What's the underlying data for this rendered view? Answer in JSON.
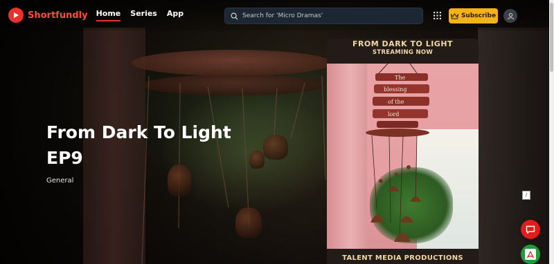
{
  "brand": {
    "name": "Shortfundly",
    "accent": "#e8322b"
  },
  "nav": [
    {
      "label": "Home",
      "active": true
    },
    {
      "label": "Series",
      "active": false
    },
    {
      "label": "App",
      "active": false
    }
  ],
  "search": {
    "placeholder": "Search for 'Micro Dramas'",
    "icon": "search-icon"
  },
  "header_actions": {
    "apps_icon": "grid-icon",
    "subscribe_label": "Subscribe",
    "subscribe_color": "#f2b318",
    "account_icon": "user-icon"
  },
  "hero": {
    "title_line1": "From Dark To Light",
    "title_line2": "EP9",
    "genre": "General"
  },
  "poster": {
    "headline": "FROM DARK TO LIGHT",
    "subline": "STREAMING NOW",
    "credit": "TALENT MEDIA PRODUCTIONS",
    "board_words": [
      "The",
      "blessing",
      "of the",
      "lord"
    ]
  },
  "floating": {
    "tag_text": "/",
    "chat_icon": "chat-icon",
    "pdf_icon": "pdf-icon",
    "chat_color": "#e21c1c",
    "pdf_color": "#1f9b3a"
  }
}
